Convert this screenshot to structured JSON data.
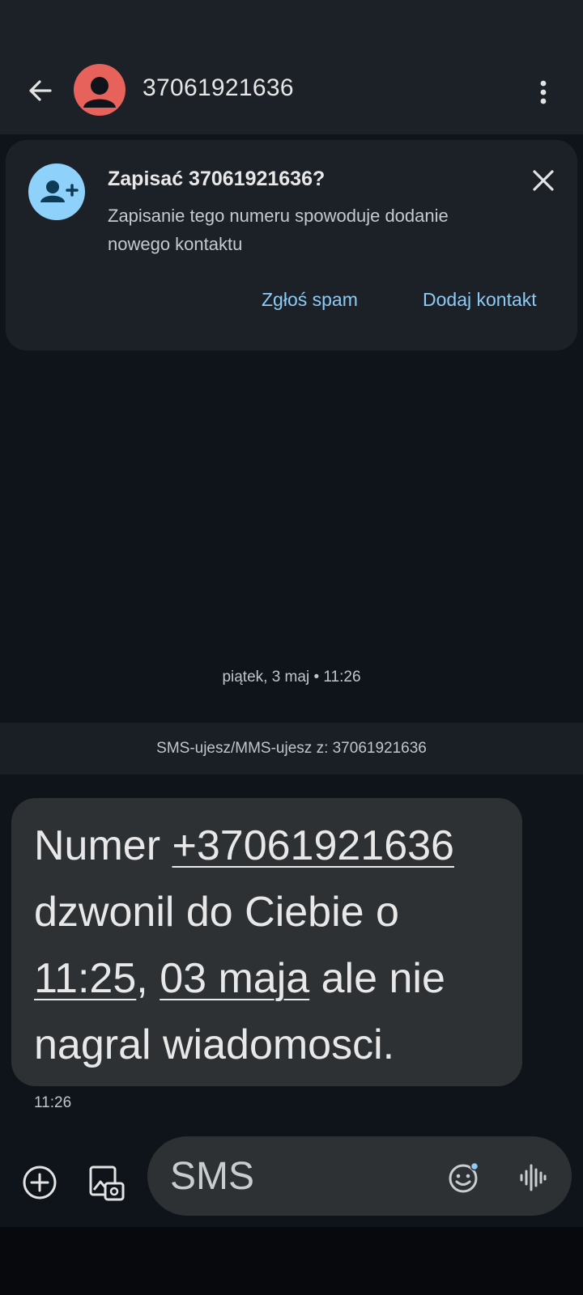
{
  "header": {
    "title": "37061921636",
    "back_icon": "arrow-back-icon",
    "avatar_icon": "person-avatar-icon",
    "more_icon": "more-vert-icon",
    "avatar_color": "#e8625c"
  },
  "save_card": {
    "title": "Zapisać 37061921636?",
    "subtitle": "Zapisanie tego numeru spowoduje dodanie nowego kontaktu",
    "icon": "person-add-icon",
    "close_icon": "close-icon",
    "report_spam": "Zgłoś spam",
    "add_contact": "Dodaj kontakt",
    "accent_color": "#8ecbf4"
  },
  "conversation": {
    "date": "piątek, 3 maj • 11:26",
    "info": "SMS-ujesz/MMS-ujesz z: 37061921636",
    "message": {
      "p1": "Numer ",
      "link_number": "+37061921636",
      "p2": "dzwonil do Ciebie o",
      "link_time": "11:25",
      "p3": ", ",
      "link_date": "03 maja",
      "p4": " ale nie",
      "p5": "nagral wiadomosci.",
      "time": "11:26"
    }
  },
  "composer": {
    "placeholder": "SMS",
    "add_icon": "add-circle-icon",
    "gallery_icon": "gallery-icon",
    "emoji_icon": "emoji-icon",
    "voice_icon": "voice-waveform-icon"
  }
}
